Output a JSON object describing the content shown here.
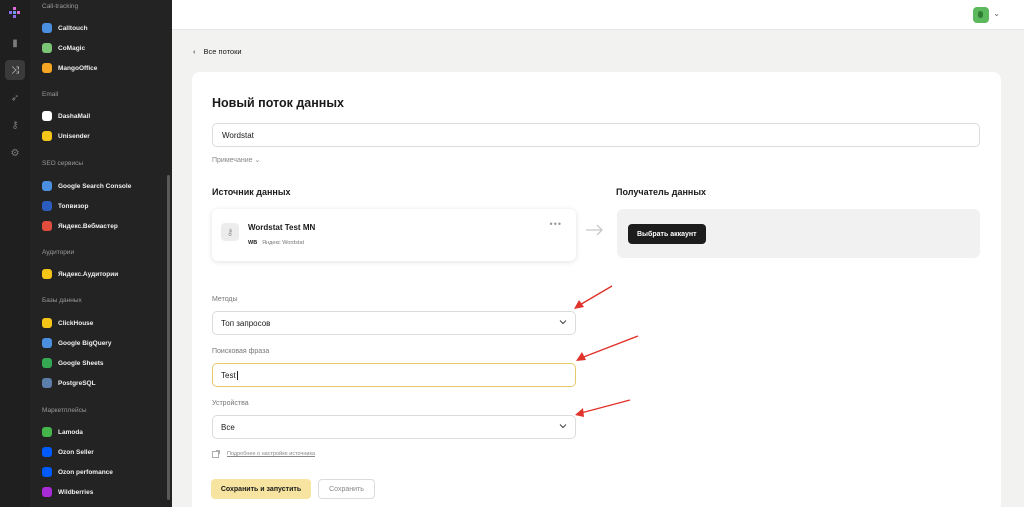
{
  "sidebar": {
    "sections": [
      {
        "title": "Call-tracking",
        "items": [
          {
            "label": "Calltouch",
            "icon": "calltouch-icon",
            "color": "#4a8fe0"
          },
          {
            "label": "CoMagic",
            "icon": "comagic-icon",
            "color": "#7cc576"
          },
          {
            "label": "MangoOffice",
            "icon": "mangooffice-icon",
            "color": "#f5a623"
          }
        ]
      },
      {
        "title": "Email",
        "items": [
          {
            "label": "DashaMail",
            "icon": "dashamail-icon",
            "color": "#ffffff"
          },
          {
            "label": "Unisender",
            "icon": "unisender-icon",
            "color": "#f5c518"
          }
        ]
      },
      {
        "title": "SEO сервисы",
        "items": [
          {
            "label": "Google Search Console",
            "icon": "google-search-console-icon",
            "color": "#4a8fe0"
          },
          {
            "label": "Топвизор",
            "icon": "topvisor-icon",
            "color": "#2b5cbf"
          },
          {
            "label": "Яндекс.Вебмастер",
            "icon": "yandex-webmaster-icon",
            "color": "#e24c3c"
          }
        ]
      },
      {
        "title": "Аудитории",
        "items": [
          {
            "label": "Яндекс.Аудитории",
            "icon": "yandex-audience-icon",
            "color": "#f5c518"
          }
        ]
      },
      {
        "title": "Базы данных",
        "items": [
          {
            "label": "ClickHouse",
            "icon": "clickhouse-icon",
            "color": "#f5c518"
          },
          {
            "label": "Google BigQuery",
            "icon": "bigquery-icon",
            "color": "#4a8fe0"
          },
          {
            "label": "Google Sheets",
            "icon": "google-sheets-icon",
            "color": "#34a853"
          },
          {
            "label": "PostgreSQL",
            "icon": "postgresql-icon",
            "color": "#5b7fa8"
          }
        ]
      },
      {
        "title": "Маркетплейсы",
        "items": [
          {
            "label": "Lamoda",
            "icon": "lamoda-icon",
            "color": "#45b649"
          },
          {
            "label": "Ozon Seller",
            "icon": "ozon-seller-icon",
            "color": "#005bff"
          },
          {
            "label": "Ozon perfomance",
            "icon": "ozon-performance-icon",
            "color": "#005bff"
          },
          {
            "label": "Wildberries",
            "icon": "wildberries-icon",
            "color": "#a72bd6"
          }
        ]
      }
    ]
  },
  "nav": {
    "back_label": "Все потоки"
  },
  "form": {
    "title": "Новый поток данных",
    "name_value": "Wordstat",
    "note_label": "Примечание",
    "source_heading": "Источник данных",
    "dest_heading": "Получатель данных",
    "source_card": {
      "name": "Wordstat Test MN",
      "badge": "WB",
      "subtitle": "Яндекс Wordstat"
    },
    "choose_account_label": "Выбрать аккаунт",
    "methods_label": "Методы",
    "methods_value": "Топ запросов",
    "phrase_label": "Поисковая фраза",
    "phrase_value": "Test",
    "devices_label": "Устройства",
    "devices_value": "Все",
    "help_link": "Подробнее о настройке источника",
    "save_run_label": "Сохранить и запустить",
    "save_label": "Сохранить"
  },
  "colors": {
    "accent": "#f6e4a0",
    "annotation_arrow": "#e0332b",
    "sidebar_bg": "#232323"
  }
}
